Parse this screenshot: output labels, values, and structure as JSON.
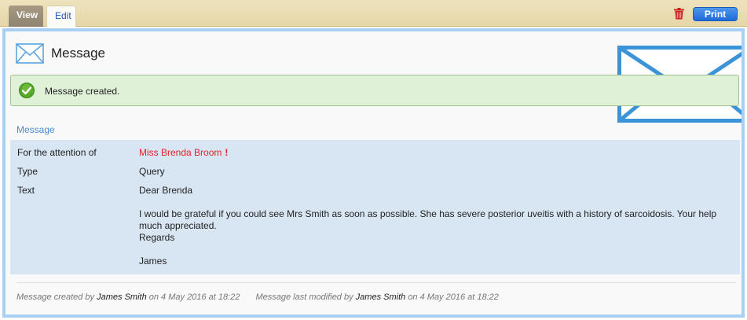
{
  "tabs": [
    {
      "label": "View",
      "active": true
    },
    {
      "label": "Edit",
      "active": false
    }
  ],
  "toolbar": {
    "delete_icon": "trash-icon",
    "print_label": "Print"
  },
  "page": {
    "title": "Message",
    "icon": "envelope-icon",
    "watermark_icon": "envelope-icon"
  },
  "alert": {
    "icon": "check-icon",
    "text": "Message created."
  },
  "section": {
    "heading": "Message"
  },
  "message": {
    "attention_label": "For the attention of",
    "attention_value": "Miss Brenda Broom",
    "attention_flag": "!",
    "type_label": "Type",
    "type_value": "Query",
    "text_label": "Text",
    "text_lines": [
      "Dear Brenda",
      "",
      "I would be grateful if you could see Mrs Smith as soon as possible. She has severe posterior uveitis with a history of sarcoidosis. Your help much appreciated.",
      "Regards",
      "",
      "James"
    ]
  },
  "footer": {
    "created_prefix": "Message created by",
    "created_by": "James Smith",
    "created_on": "on 4 May 2016 at 18:22",
    "modified_prefix": "Message last modified by",
    "modified_by": "James Smith",
    "modified_on": "on 4 May 2016 at 18:22"
  },
  "colors": {
    "accent": "#4a8ad2",
    "tabbar": "#e6d6a8",
    "success_bg": "#dff2d8",
    "details_bg": "#d8e5f2",
    "attention": "#e0222a",
    "print_button": "#1f6ad8"
  }
}
